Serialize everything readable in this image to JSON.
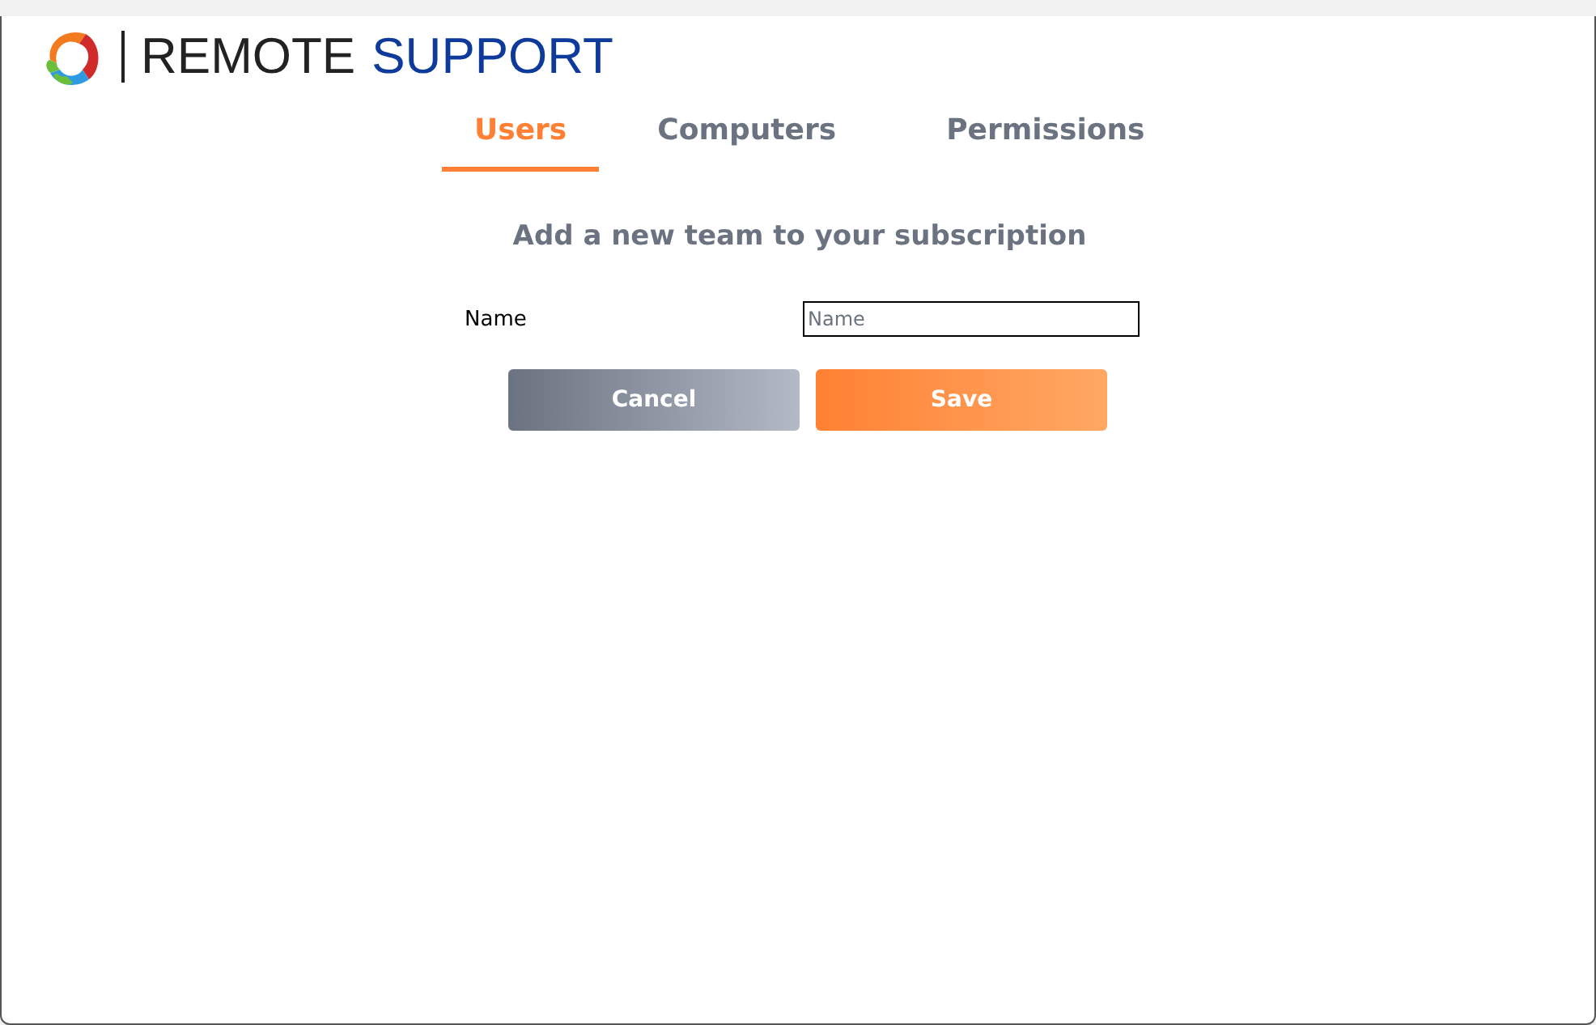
{
  "logo": {
    "word_1": "REMOTE",
    "word_2": "SUPPORT"
  },
  "tabs": [
    {
      "label": "Users",
      "selected": true
    },
    {
      "label": "Computers",
      "selected": false
    },
    {
      "label": "Permissions",
      "selected": false
    }
  ],
  "heading": "Add a new team to your subscription",
  "form": {
    "label": "Name",
    "placeholder": "Name"
  },
  "buttons": [
    {
      "label": "Cancel",
      "kind": "secondary"
    },
    {
      "label": "Save",
      "kind": "primary"
    }
  ]
}
